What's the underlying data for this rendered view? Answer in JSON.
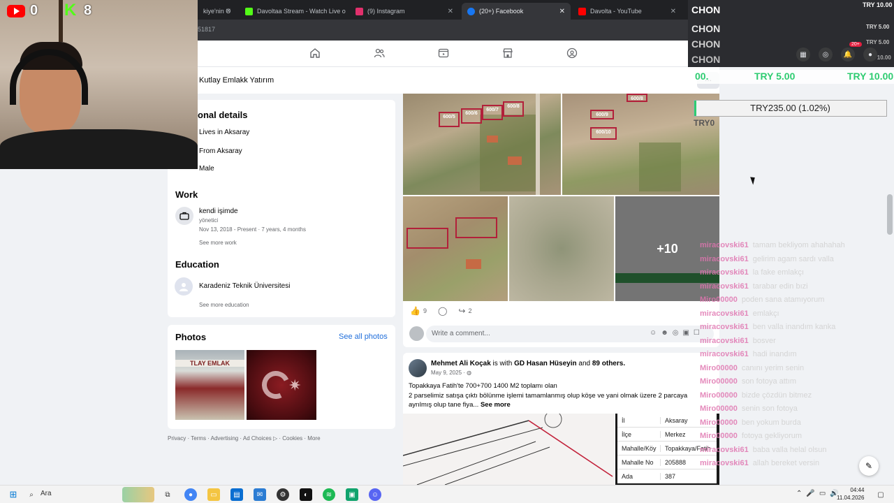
{
  "browser": {
    "tabs": [
      {
        "label": "kiye'nin O",
        "color": "#888888"
      },
      {
        "label": "Davoltaa Stream - Watch Live o",
        "color": "#53fc18"
      },
      {
        "label": "(9) Instagram",
        "color": "#e1306c"
      },
      {
        "label": "(20+) Facebook",
        "color": "#1877f2"
      },
      {
        "label": "Davolta - YouTube",
        "color": "#ff0000"
      }
    ],
    "url_fragment": "51817"
  },
  "profile": {
    "name": "Kutlay Emlakk Yatırım",
    "more_button": "..."
  },
  "intro": {
    "title": "onal details",
    "lives": "Lives in Aksaray",
    "from": "From Aksaray",
    "gender": "Male",
    "work_title": "Work",
    "work_company": "kendi işimde",
    "work_role": "yönetici",
    "work_dates": "Nov 13, 2018 - Present · 7 years, 4 months",
    "see_more_work": "See more work",
    "education_title": "Education",
    "school": "Karadeniz Teknik Üniversitesi",
    "see_more_education": "See more education"
  },
  "photos": {
    "title": "Photos",
    "see_all": "See all photos",
    "photo1_sign": "TLAY EMLAK"
  },
  "footer": "Privacy · Terms · Advertising · Ad Choices ▷ · Cookies · More",
  "post1": {
    "plots_a": [
      "600/5",
      "600/6",
      "600/7",
      "600/8"
    ],
    "plots_b": [
      "600/8",
      "600/9",
      "600/10"
    ],
    "more_photos": "+10",
    "likes": "9",
    "shares": "2",
    "comment_placeholder": "Write a comment..."
  },
  "post2": {
    "author": "Mehmet Ali Koçak",
    "with_text": "is with",
    "tagged": "GD Hasan Hüseyin",
    "and_text": "and",
    "others": "89 others.",
    "date": "May 9, 2025 · ",
    "text_line1": "Topakkaya Fatih'te  700+700 1400 M2 toplamı olan",
    "text_line2": "2 parselimiz satışa çıktı   bölünme işlemi tamamlanmış olup köşe ve yani olmak üzere 2 parcaya ayrılmış olup tane fiya...",
    "see_more": "See more",
    "table": [
      {
        "k": "İl",
        "v": "Aksaray"
      },
      {
        "k": "İlçe",
        "v": "Merkez"
      },
      {
        "k": "Mahalle/Köy",
        "v": "Topakkaya/Fatih"
      },
      {
        "k": "Mahalle No",
        "v": "205888"
      },
      {
        "k": "Ada",
        "v": "387"
      }
    ]
  },
  "stream": {
    "yt_count": "0",
    "kick_count": "8",
    "kick_letter": "K",
    "chon_lines": [
      "CHON",
      "CHON",
      "CHON",
      "CHON"
    ],
    "try_top": "TRY 10.00",
    "try_small": [
      "TRY 5.00",
      "TRY 5.00",
      "TRY 10.00"
    ],
    "notif_badge": "20+",
    "donations": [
      "TRY 5.00",
      "TRY 10.00"
    ],
    "don_prefix": "00.",
    "goal": "TRY235.00 (1.02%)",
    "goal_fraction": 0.0102,
    "try0": "TRY0",
    "chat": [
      {
        "u": "miracovski61",
        "m": "tamam bekliyom ahahahah"
      },
      {
        "u": "miracovski61",
        "m": "gelirim agam sardı valla"
      },
      {
        "u": "miracovski61",
        "m": "la fake emlakçı"
      },
      {
        "u": "miracovski61",
        "m": "tarabar edin bızi"
      },
      {
        "u": "Miro00000",
        "m": "poden sana atamıyorum"
      },
      {
        "u": "miracovski61",
        "m": "emlakçı"
      },
      {
        "u": "miracovski61",
        "m": "ben valla inandım kanka"
      },
      {
        "u": "miracovski61",
        "m": "bosver"
      },
      {
        "u": "miracovski61",
        "m": "hadi inandım"
      },
      {
        "u": "Miro00000",
        "m": "canını yerim senin"
      },
      {
        "u": "Miro00000",
        "m": "son fotoya attım"
      },
      {
        "u": "Miro00000",
        "m": "bizde çözdün bitmez"
      },
      {
        "u": "Miro00000",
        "m": "senin son fotoya"
      },
      {
        "u": "Miro00000",
        "m": "ben yokum burda"
      },
      {
        "u": "Miro00000",
        "m": "fotoya gekliyorum"
      },
      {
        "u": "miracovski61",
        "m": "baba valla helal olsun"
      },
      {
        "u": "miracovski61",
        "m": "allah bereket versin"
      }
    ]
  },
  "taskbar": {
    "search": "Ara",
    "time": "04:44",
    "date": "11.04.2026"
  }
}
